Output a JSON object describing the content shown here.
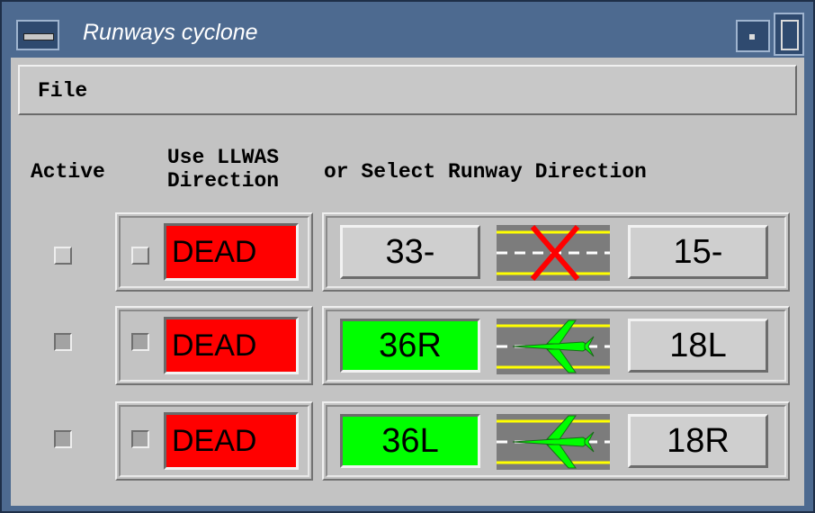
{
  "window": {
    "title": "Runways cyclone"
  },
  "menu": {
    "file": "File"
  },
  "headers": {
    "active": "Active",
    "use_llwas": "Use LLWAS\nDirection",
    "select": "or Select Runway Direction"
  },
  "colors": {
    "dead": "#ff0000",
    "active_direction": "#00ff00",
    "runway_line": "#ffff00",
    "closed_x": "#ff0000",
    "aircraft": "#00ff00"
  },
  "rows": [
    {
      "active_checked": false,
      "llwas_checked": false,
      "llwas_status": "DEAD",
      "left_dir": "33-",
      "right_dir": "15-",
      "selected": "none",
      "runway_icon": "runway-closed-x-icon"
    },
    {
      "active_checked": true,
      "llwas_checked": true,
      "llwas_status": "DEAD",
      "left_dir": "36R",
      "right_dir": "18L",
      "selected": "left",
      "runway_icon": "aircraft-on-runway-icon"
    },
    {
      "active_checked": true,
      "llwas_checked": true,
      "llwas_status": "DEAD",
      "left_dir": "36L",
      "right_dir": "18R",
      "selected": "left",
      "runway_icon": "aircraft-on-runway-icon"
    }
  ]
}
